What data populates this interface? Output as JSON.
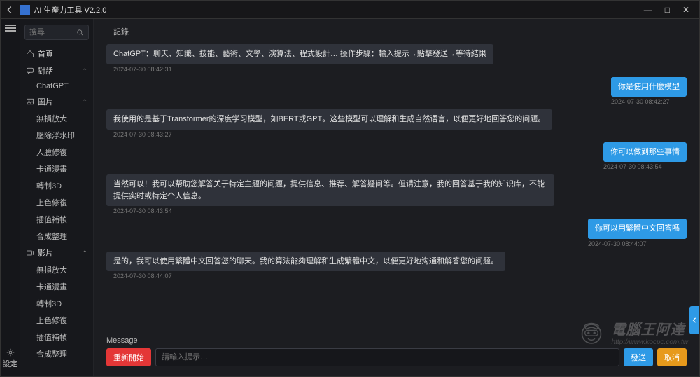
{
  "titlebar": {
    "title": "AI 生產力工具 V2.2.0"
  },
  "search": {
    "placeholder": "搜尋"
  },
  "nav": {
    "home": "首頁",
    "chat": "對話",
    "chat_child": "ChatGPT",
    "image": "圖片",
    "image_children": [
      "無損放大",
      "壓除浮水印",
      "人臉修復",
      "卡通漫畫",
      "轉制3D",
      "上色修復",
      "插值補幀",
      "合成整理"
    ],
    "video": "影片",
    "video_children": [
      "無損放大",
      "卡通漫畫",
      "轉制3D",
      "上色修復",
      "插值補幀",
      "合成整理"
    ],
    "settings": "設定"
  },
  "labels": {
    "record": "記錄",
    "message": "Message"
  },
  "buttons": {
    "restart": "重新開始",
    "send": "發送",
    "cancel": "取消"
  },
  "input": {
    "placeholder": "請輸入提示…"
  },
  "chat": [
    {
      "role": "bot",
      "text": "ChatGPT：聊天、知識、技能、藝術、文學、演算法、程式設計…\n操作步驟：輸入提示→點擊發送→等待結果",
      "ts": "2024-07-30 08:42:31"
    },
    {
      "role": "user",
      "text": "你是使用什麼模型",
      "ts": "2024-07-30 08:42:27"
    },
    {
      "role": "bot",
      "text": "我使用的是基于Transformer的深度学习模型，如BERT或GPT。这些模型可以理解和生成自然语言，以便更好地回答您的问题。",
      "ts": "2024-07-30 08:43:27"
    },
    {
      "role": "user",
      "text": "你可以做到那些事情",
      "ts": "2024-07-30 08:43:54"
    },
    {
      "role": "bot",
      "text": "当然可以！我可以帮助您解答关于特定主题的问题，提供信息、推荐、解答疑问等。但请注意，我的回答基于我的知识库，不能提供实时或特定个人信息。",
      "ts": "2024-07-30 08:43:54"
    },
    {
      "role": "user",
      "text": "你可以用繁體中文回答嗎",
      "ts": "2024-07-30 08:44:07"
    },
    {
      "role": "bot",
      "text": "是的，我可以使用繁體中文回答您的聊天。我的算法能夠理解和生成繁體中文，以便更好地沟通和解答您的问题。",
      "ts": "2024-07-30 08:44:07"
    }
  ],
  "watermark": {
    "brand": "電腦王阿達",
    "url": "http://www.kocpc.com.tw"
  }
}
